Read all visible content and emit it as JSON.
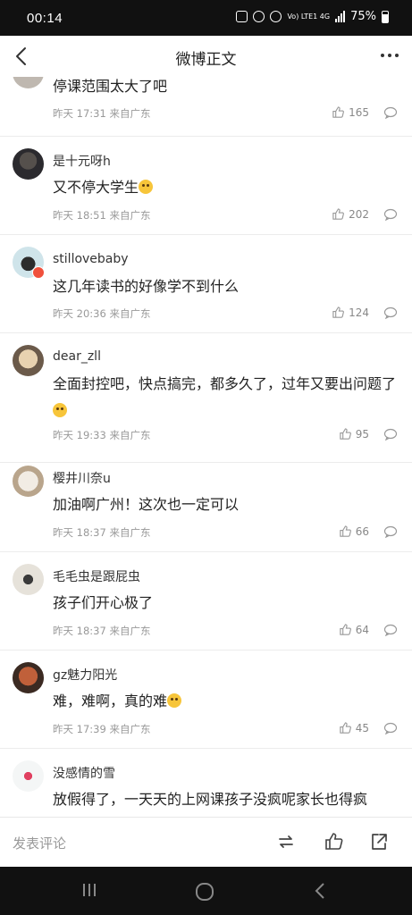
{
  "status": {
    "time": "00:14",
    "network": "Vo) LTE1 4G",
    "battery": "75%"
  },
  "nav": {
    "title": "微博正文"
  },
  "comments": [
    {
      "name": "",
      "text": "停课范围太大了吧",
      "time": "昨天 17:31",
      "source": "来自广东",
      "likes": "165"
    },
    {
      "name": "是十元呀h",
      "text": "又不停大学生",
      "time": "昨天 18:51",
      "source": "来自广东",
      "likes": "202"
    },
    {
      "name": "stillovebaby",
      "text": "这几年读书的好像学不到什么",
      "time": "昨天 20:36",
      "source": "来自广东",
      "likes": "124"
    },
    {
      "name": "dear_zll",
      "text": "全面封控吧，快点搞完，都多久了，过年又要出问题了",
      "time": "昨天 19:33",
      "source": "来自广东",
      "likes": "95"
    },
    {
      "name": "樱井川奈u",
      "text": "加油啊广州！这次也一定可以",
      "time": "昨天 18:37",
      "source": "来自广东",
      "likes": "66"
    },
    {
      "name": "毛毛虫是跟屁虫",
      "text": "孩子们开心极了",
      "time": "昨天 18:37",
      "source": "来自广东",
      "likes": "64"
    },
    {
      "name": "gz魅力阳光",
      "text": "难，难啊，真的难",
      "time": "昨天 17:39",
      "source": "来自广东",
      "likes": "45"
    },
    {
      "name": "没感情的雪",
      "text": "放假得了，一天天的上网课孩子没疯呢家长也得疯",
      "time": "",
      "source": "",
      "likes": ""
    }
  ],
  "bottom": {
    "placeholder": "发表评论"
  },
  "colors": {
    "accent": "#f0503c",
    "meta": "#999999",
    "divider": "#ececec"
  }
}
